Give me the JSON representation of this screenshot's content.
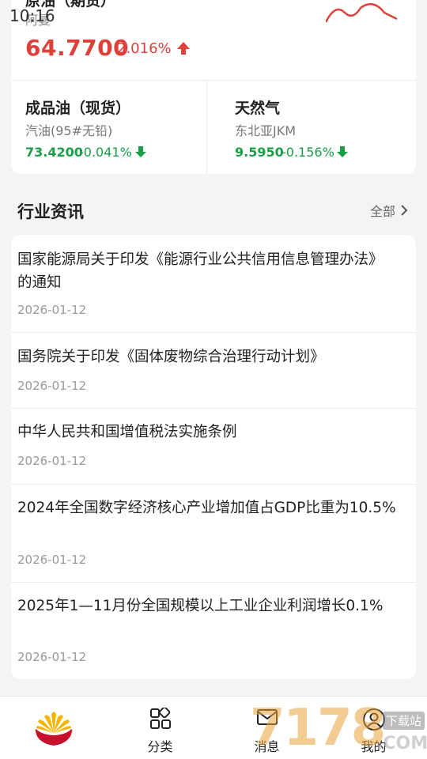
{
  "status_bar": {
    "time": "10:16"
  },
  "top_card": {
    "crude": {
      "name": "原油（期货）",
      "sub": "阿曼",
      "price": "64.7700",
      "change": "2.016%",
      "direction": "up"
    },
    "items": [
      {
        "name": "成品油（现货）",
        "desc": "汽油(95#无铅)",
        "price": "73.4200",
        "change": "-0.041%",
        "direction": "down"
      },
      {
        "name": "天然气",
        "desc": "东北亚JKM",
        "price": "9.5950",
        "change": "-0.156%",
        "direction": "down"
      }
    ]
  },
  "section": {
    "title": "行业资讯",
    "more": "全部"
  },
  "news": [
    {
      "title": "国家能源局关于印发《能源行业公共信用信息管理办法》的通知",
      "date": "2026-01-12"
    },
    {
      "title": "国务院关于印发《固体废物综合治理行动计划》",
      "date": "2026-01-12"
    },
    {
      "title": "中华人民共和国增值税法实施条例",
      "date": "2026-01-12"
    },
    {
      "title": "2024年全国数字经济核心产业增加值占GDP比重为10.5%",
      "date": "2026-01-12"
    },
    {
      "title": "2025年1—11月份全国规模以上工业企业利润增长0.1%",
      "date": "2026-01-12"
    }
  ],
  "bottom_nav": [
    {
      "label": "",
      "icon": "home-logo"
    },
    {
      "label": "分类",
      "icon": "grid-icon"
    },
    {
      "label": "消息",
      "icon": "mail-icon"
    },
    {
      "label": "我的",
      "icon": "user-icon"
    }
  ],
  "watermark": {
    "text": "7178",
    "sub": "下载站",
    "domain": ".COM"
  },
  "colors": {
    "up": "#e0403a",
    "down": "#1a9e48",
    "accent": "#e0403a"
  }
}
